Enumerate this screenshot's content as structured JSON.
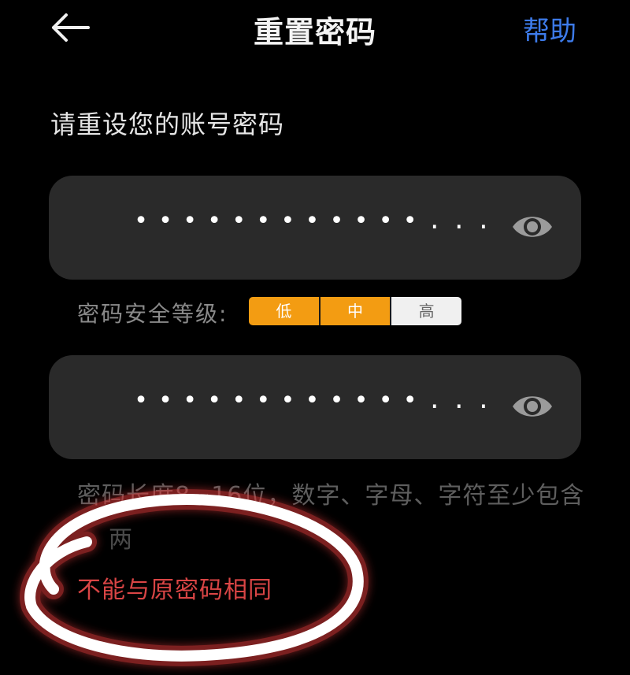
{
  "header": {
    "back_icon": "arrow-left-icon",
    "title": "重置密码",
    "help_label": "帮助"
  },
  "subtitle": "请重设您的账号密码",
  "password_field": {
    "value": "••••••••••••...",
    "eye_icon": "eye-icon"
  },
  "strength": {
    "label": "密码安全等级:",
    "levels": [
      "低",
      "中",
      "高"
    ],
    "active_count": 2,
    "active_color": "#f39c12"
  },
  "confirm_field": {
    "value": "••••••••••••...",
    "eye_icon": "eye-icon"
  },
  "hints": {
    "rule": "密码长度8~16位，数字、字母、字符至少包含",
    "rule_continued": "两",
    "error": "不能与原密码相同"
  },
  "colors": {
    "accent": "#3d7bea",
    "error": "#d94545",
    "annotation": "#ffffff"
  }
}
